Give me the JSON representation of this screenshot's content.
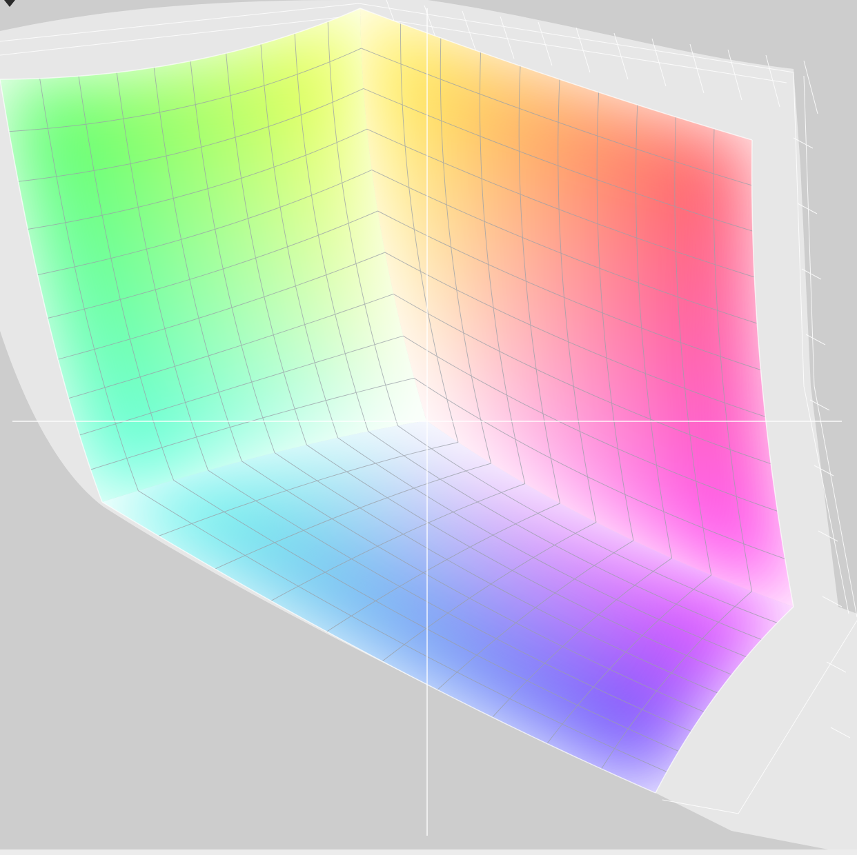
{
  "viewer": {
    "background": "#cdcdcd",
    "reference_shell_color": "#e6e6e6",
    "crosshair_color": "#ffffff",
    "grid_divisions": 10
  },
  "corners": {
    "white": "#ffffff",
    "red": "#ff4d5a",
    "yellow": "#ffff3c",
    "green": "#4dff66",
    "cyan": "#4dffe6",
    "blue": "#5a4dff",
    "magenta": "#ff33ff"
  },
  "icons": {
    "corner_marker": "triangle-down-icon"
  }
}
